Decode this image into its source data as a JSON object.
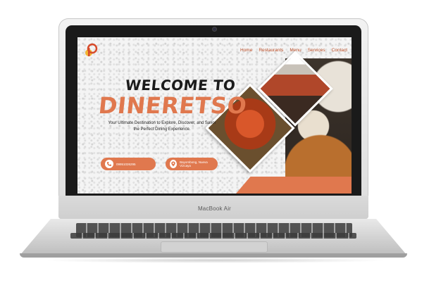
{
  "device": {
    "brand_label": "MacBook Air"
  },
  "site": {
    "nav": [
      "Home",
      "Restaurants",
      "Menu",
      "Services",
      "Contact"
    ],
    "welcome": "WELCOME TO",
    "title": "DINERETSO",
    "tagline": "Your Ultimate Destination to Explore, Discover, and Savor the Perfect Dining Experience.",
    "phone": "09951026295",
    "location": "Bayombong, Nueva Vizcaya"
  },
  "colors": {
    "accent": "#e0784e",
    "text": "#1b1b1b"
  },
  "icons": {
    "phone": "phone-icon",
    "location": "map-pin-icon",
    "logo": "dineretso-logo"
  }
}
